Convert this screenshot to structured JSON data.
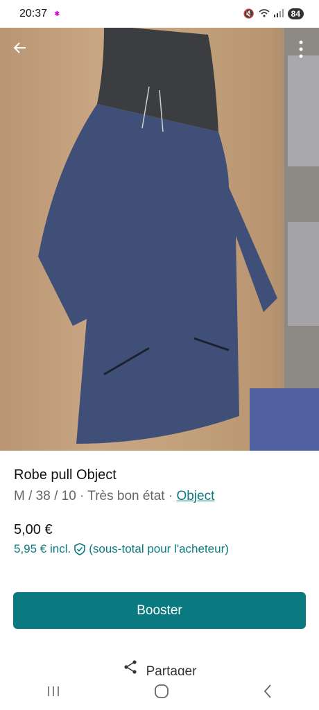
{
  "status": {
    "time": "20:37",
    "battery": "84"
  },
  "photo": {
    "back_icon": "arrow-left-icon",
    "more_icon": "more-vertical-icon"
  },
  "item": {
    "title": "Robe pull Object",
    "meta_text": "M / 38 / 10 · Très bon état · ",
    "brand": "Object",
    "price": "5,00 €",
    "price_incl": "5,95 €  incl.",
    "price_incl_note": "(sous-total pour l'acheteur)"
  },
  "actions": {
    "boost_label": "Booster",
    "share_label": "Partager"
  },
  "colors": {
    "accent": "#0b7a80",
    "link": "#0a7a7f"
  }
}
